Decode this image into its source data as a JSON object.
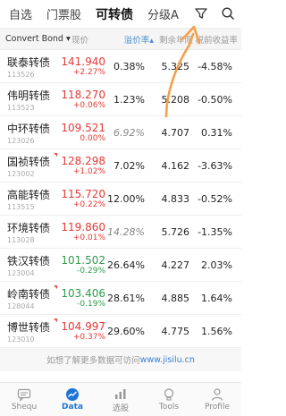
{
  "tabs": [
    {
      "label": "自选",
      "active": false
    },
    {
      "label": "门票股",
      "active": false
    },
    {
      "label": "可转债",
      "active": true
    },
    {
      "label": "分级A",
      "active": false
    }
  ],
  "header": {
    "name": "Convert Bond",
    "price": "现价",
    "premium": "溢价率",
    "years": "剩余年限",
    "yield": "税前收益率"
  },
  "rows": [
    {
      "name": "联泰转债",
      "code": "113526",
      "price": "141.940",
      "change": "+2.27%",
      "dir": "up",
      "premium": "0.38%",
      "premium_italic": false,
      "years": "5.325",
      "yield": "-4.58%",
      "flag": false
    },
    {
      "name": "伟明转债",
      "code": "113523",
      "price": "118.270",
      "change": "+0.06%",
      "dir": "up",
      "premium": "1.23%",
      "premium_italic": false,
      "years": "5.208",
      "yield": "-0.50%",
      "flag": false
    },
    {
      "name": "中环转债",
      "code": "123026",
      "price": "109.521",
      "change": "0.00%",
      "dir": "up",
      "premium": "6.92%",
      "premium_italic": true,
      "years": "4.707",
      "yield": "0.31%",
      "flag": false
    },
    {
      "name": "国祯转债",
      "code": "123002",
      "price": "128.298",
      "change": "+1.02%",
      "dir": "up",
      "premium": "7.02%",
      "premium_italic": false,
      "years": "4.162",
      "yield": "-3.63%",
      "flag": true
    },
    {
      "name": "高能转债",
      "code": "113515",
      "price": "115.720",
      "change": "+0.22%",
      "dir": "up",
      "premium": "12.00%",
      "premium_italic": false,
      "years": "4.833",
      "yield": "-0.52%",
      "flag": false
    },
    {
      "name": "环境转债",
      "code": "113028",
      "price": "119.860",
      "change": "+0.01%",
      "dir": "up",
      "premium": "14.28%",
      "premium_italic": true,
      "years": "5.726",
      "yield": "-1.35%",
      "flag": false
    },
    {
      "name": "铁汉转债",
      "code": "123004",
      "price": "101.502",
      "change": "-0.29%",
      "dir": "down",
      "premium": "26.64%",
      "premium_italic": false,
      "years": "4.227",
      "yield": "2.03%",
      "flag": false
    },
    {
      "name": "岭南转债",
      "code": "128044",
      "price": "103.406",
      "change": "-0.19%",
      "dir": "down",
      "premium": "28.61%",
      "premium_italic": false,
      "years": "4.885",
      "yield": "1.64%",
      "flag": true
    },
    {
      "name": "博世转债",
      "code": "123010",
      "price": "104.997",
      "change": "+0.37%",
      "dir": "up",
      "premium": "29.60%",
      "premium_italic": false,
      "years": "4.775",
      "yield": "1.56%",
      "flag": true
    }
  ],
  "footnote": {
    "text": "如想了解更多数据可访问",
    "link": "www.jisilu.cn"
  },
  "nav": [
    {
      "label": "Shequ",
      "icon": "community-icon",
      "active": false
    },
    {
      "label": "Data",
      "icon": "data-chart-icon",
      "active": true
    },
    {
      "label": "选股",
      "icon": "bar-chart-icon",
      "active": false
    },
    {
      "label": "Tools",
      "icon": "lightbulb-icon",
      "active": false
    },
    {
      "label": "Profile",
      "icon": "person-icon",
      "active": false
    }
  ],
  "colors": {
    "up": "#e53935",
    "down": "#2e9b4a",
    "accent": "#1e74d6",
    "annotation": "#f5a04a"
  }
}
